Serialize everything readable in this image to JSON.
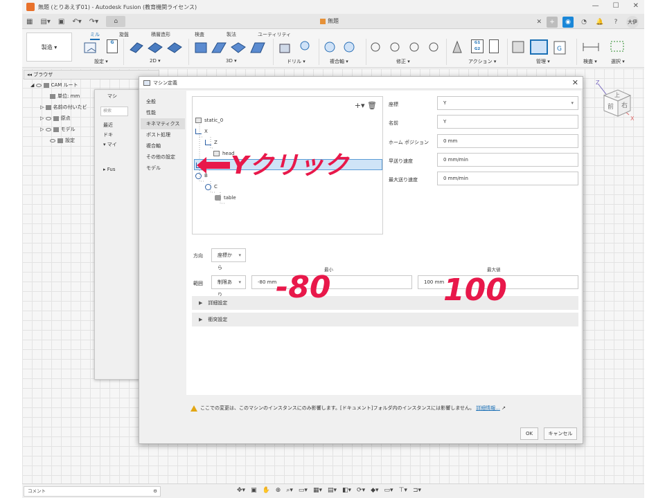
{
  "window": {
    "title": "無題 (とりあえず01) - Autodesk Fusion (教育機関ライセンス)",
    "controls": [
      "—",
      "☐",
      "✕"
    ]
  },
  "doc_tab": {
    "label": "無題"
  },
  "avatar": {
    "initials": "大伊"
  },
  "ribbon": {
    "workspace": "製造 ▾",
    "tabs": [
      "ミル",
      "旋盤",
      "積層造形",
      "検査",
      "製法",
      "ユーティリティ"
    ],
    "groups": [
      "設定 ▾",
      "2D ▾",
      "3D ▾",
      "ドリル ▾",
      "複合軸 ▾",
      "修正 ▾",
      "アクション ▾",
      "管理 ▾",
      "検査 ▾",
      "選択 ▾"
    ],
    "setup_badge": "G",
    "action_badge": "G1 G2"
  },
  "browser": {
    "header": "ブラウザ",
    "items": [
      {
        "label": "CAM ルート"
      },
      {
        "label": "単位: mm"
      },
      {
        "label": "名前の付いたビ"
      },
      {
        "label": "原点"
      },
      {
        "label": "モデル"
      },
      {
        "label": "設定"
      }
    ]
  },
  "behind_dialog": {
    "title": "マシ",
    "search_placeholder": "検索",
    "items": [
      "最近",
      "ドキ",
      "▾ マイ",
      "▸ Fus"
    ]
  },
  "viewcube": {
    "front": "前",
    "right": "右",
    "top": "上",
    "axis_x": "X",
    "axis_z": "Z"
  },
  "dialog": {
    "title": "マシン定義",
    "close": "✕",
    "nav": [
      "全般",
      "性能",
      "キネマティクス",
      "ポスト処理",
      "複合軸",
      "その他の設定",
      "モデル"
    ],
    "selected_nav": "キネマティクス",
    "tree_tools": {
      "add": "+▾",
      "delete": "🗑"
    },
    "tree": [
      {
        "label": "static_0"
      },
      {
        "label": "X"
      },
      {
        "label": "Z"
      },
      {
        "label": "head"
      },
      {
        "label": "Y"
      },
      {
        "label": "B"
      },
      {
        "label": "C"
      },
      {
        "label": "table"
      }
    ],
    "props": {
      "coord_label": "座標",
      "coord_value": "Y",
      "name_label": "名前",
      "name_value": "Y",
      "home_label": "ホーム ポジション",
      "home_value": "0 mm",
      "rapid_label": "早送り速度",
      "rapid_value": "0 mm/min",
      "max_feed_label": "最大送り速度",
      "max_feed_value": "0 mm/min"
    },
    "direction_label": "方向",
    "direction_value": "座標から",
    "range_label": "範囲",
    "range_value": "制限あり",
    "min_label": "最小",
    "min_value": "-80 mm",
    "max_label": "最大値",
    "max_value": "100 mm",
    "advanced": "詳細設定",
    "collision": "衝突設定",
    "warning": "ここでの変更は、このマシンのインスタンスにのみ影響します。[ドキュメント]フォルダ内のインスタンスには影響しません。",
    "warning_link": "詳細情報...",
    "ok": "OK",
    "cancel": "キャンセル"
  },
  "annotations": {
    "click_y": "Yクリック",
    "min": "-80",
    "max": "100",
    "color": "#e8184a"
  },
  "bottom": {
    "comment": "コメント",
    "settings_icon": "⚙"
  }
}
